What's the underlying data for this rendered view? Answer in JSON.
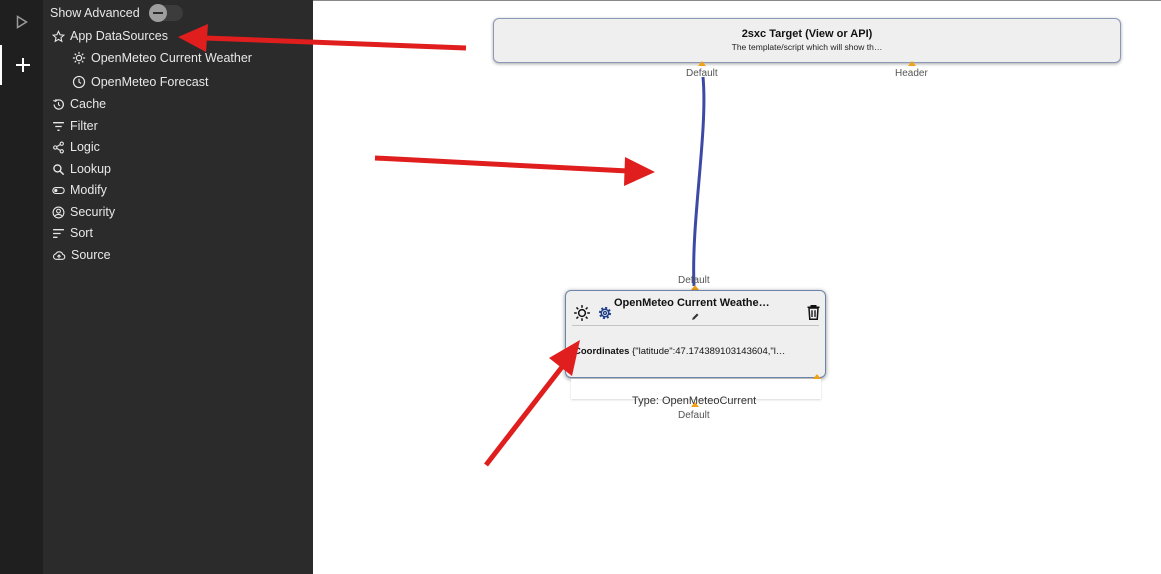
{
  "sidebar": {
    "show_advanced_label": "Show Advanced",
    "items": [
      {
        "label": "App DataSources",
        "icon": "star-icon"
      },
      {
        "label": "OpenMeteo Current Weather",
        "icon": "sun-icon"
      },
      {
        "label": "OpenMeteo Forecast",
        "icon": "clock-icon"
      },
      {
        "label": "Cache",
        "icon": "history-icon"
      },
      {
        "label": "Filter",
        "icon": "filter-icon"
      },
      {
        "label": "Logic",
        "icon": "share-icon"
      },
      {
        "label": "Lookup",
        "icon": "search-icon"
      },
      {
        "label": "Modify",
        "icon": "toggle-icon"
      },
      {
        "label": "Security",
        "icon": "account-icon"
      },
      {
        "label": "Sort",
        "icon": "sort-icon"
      },
      {
        "label": "Source",
        "icon": "cloud-upload-icon"
      }
    ]
  },
  "canvas": {
    "target": {
      "title": "2sxc Target (View or API)",
      "description": "The template/script which will show th…",
      "ports": [
        "Default",
        "Header"
      ]
    },
    "datasource": {
      "title": "OpenMeteo Current Weathe…",
      "in_port": "Default",
      "property_name": "Coordinates",
      "property_value": "{\"latitude\":47.174389103143604,\"l…",
      "type_label": "Type: OpenMeteoCurrent",
      "out_port": "Default"
    }
  },
  "colors": {
    "rail": "#1f1f1f",
    "panel": "#2b2b2b",
    "connection": "#3c4aa6",
    "port": "#f0a318",
    "arrow": "#e01e1e"
  }
}
